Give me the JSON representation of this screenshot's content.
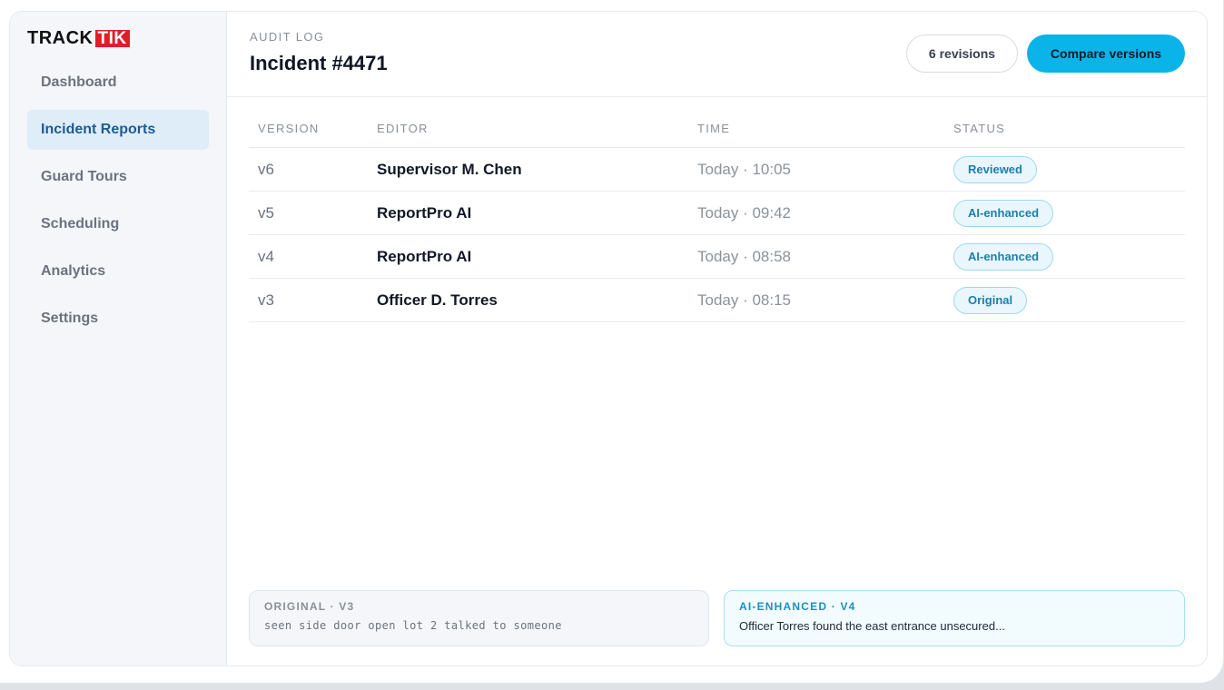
{
  "brand": {
    "part1": "TRACK",
    "part2": "TIK",
    "accent": "#e01e2b"
  },
  "sidebar": {
    "items": [
      {
        "label": "Dashboard",
        "active": false
      },
      {
        "label": "Incident Reports",
        "active": true
      },
      {
        "label": "Guard Tours",
        "active": false
      },
      {
        "label": "Scheduling",
        "active": false
      },
      {
        "label": "Analytics",
        "active": false
      },
      {
        "label": "Settings",
        "active": false
      }
    ]
  },
  "header": {
    "eyebrow": "AUDIT LOG",
    "title": "Incident #4471",
    "revisions_label": "6 revisions",
    "compare_label": "Compare versions",
    "compare_color": "#0ab4e8"
  },
  "table": {
    "columns": [
      "VERSION",
      "EDITOR",
      "TIME",
      "STATUS"
    ],
    "rows": [
      {
        "version": "v6",
        "editor": "Supervisor M. Chen",
        "time": "Today · 10:05",
        "status": "Reviewed"
      },
      {
        "version": "v5",
        "editor": "ReportPro AI",
        "time": "Today · 09:42",
        "status": "AI-enhanced"
      },
      {
        "version": "v4",
        "editor": "ReportPro AI",
        "time": "Today · 08:58",
        "status": "AI-enhanced"
      },
      {
        "version": "v3",
        "editor": "Officer D. Torres",
        "time": "Today · 08:15",
        "status": "Original"
      }
    ]
  },
  "compare": {
    "original": {
      "label": "ORIGINAL · V3",
      "text": "seen side door open lot 2 talked to someone"
    },
    "enhanced": {
      "label": "AI-ENHANCED · V4",
      "text": "Officer Torres found the east entrance unsecured..."
    }
  }
}
